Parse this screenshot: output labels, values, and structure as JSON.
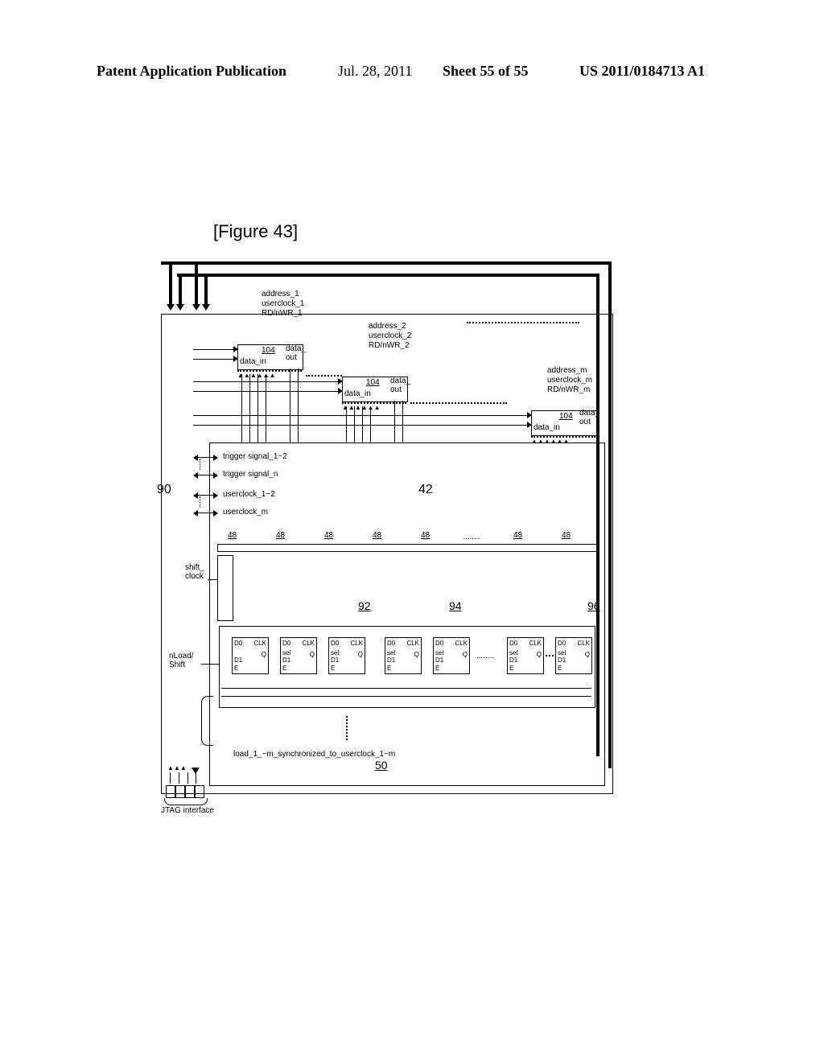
{
  "header": {
    "left": "Patent Application Publication",
    "date": "Jul. 28, 2011",
    "sheet": "Sheet 55 of 55",
    "pubno": "US 2011/0184713 A1"
  },
  "figure_label": "[Figure 43]",
  "blocks": {
    "b1": {
      "addr": "address_1",
      "clk": "userclock_1",
      "rw": "RD/nWR_1",
      "num": "104",
      "din": "data_in",
      "dout": "data_\nout"
    },
    "b2": {
      "addr": "address_2",
      "clk": "userclock_2",
      "rw": "RD/nWR_2",
      "num": "104",
      "din": "data_in",
      "dout": "data_\nout"
    },
    "bm": {
      "addr": "address_m",
      "clk": "userclock_m",
      "rw": "RD/nWR_m",
      "num": "104",
      "din": "data_in",
      "dout": "data_\nout"
    }
  },
  "refs": {
    "r90": "90",
    "r42": "42",
    "r48": "48",
    "r92": "92",
    "r94": "94",
    "r96": "96",
    "r50": "50"
  },
  "signals": {
    "trig12": "trigger signal_1~2",
    "trign": "trigger signal_n",
    "uclk12": "userclock_1~2",
    "uclkm": "userclock_m",
    "shiftclk": "shift_\nclock",
    "nload": "nLoad/\nShift",
    "loadsync": "load_1_~m_synchronized_to_userclock_1~m"
  },
  "jtag": "JTAG interface",
  "ff": {
    "d0": "D0",
    "d1": "D1",
    "clk": "CLK",
    "sel": "sel",
    "e": "E",
    "q": "Q"
  },
  "ellipsis": "........"
}
